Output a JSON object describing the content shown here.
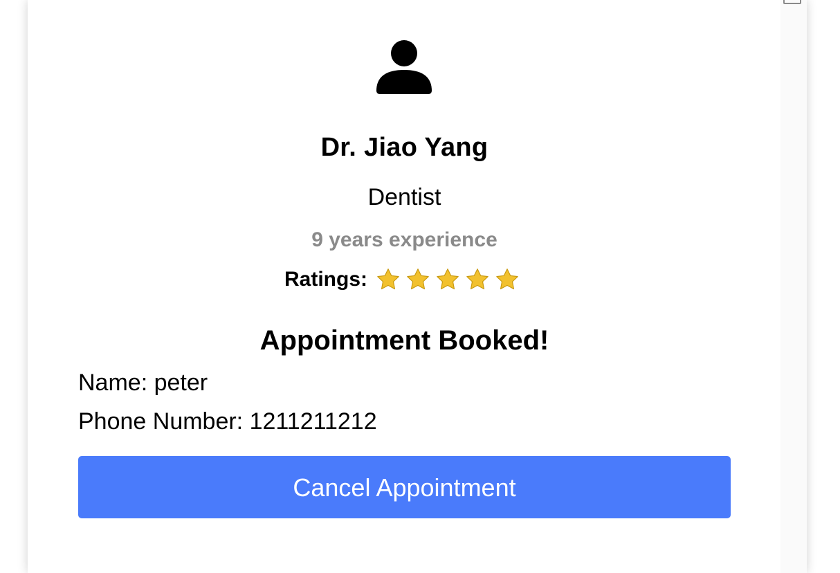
{
  "doctor": {
    "avatar_icon": "user-icon",
    "name": "Dr. Jiao Yang",
    "specialty": "Dentist",
    "experience": "9 years experience",
    "ratings_label": "Ratings:",
    "rating_stars": 5,
    "star_icon": "star-icon",
    "star_color": "#F2C12E"
  },
  "appointment": {
    "title": "Appointment Booked!",
    "name_line": "Name: peter",
    "phone_line": "Phone Number: 1211211212",
    "cancel_label": "Cancel Appointment",
    "cancel_color": "#4A7BFB"
  }
}
